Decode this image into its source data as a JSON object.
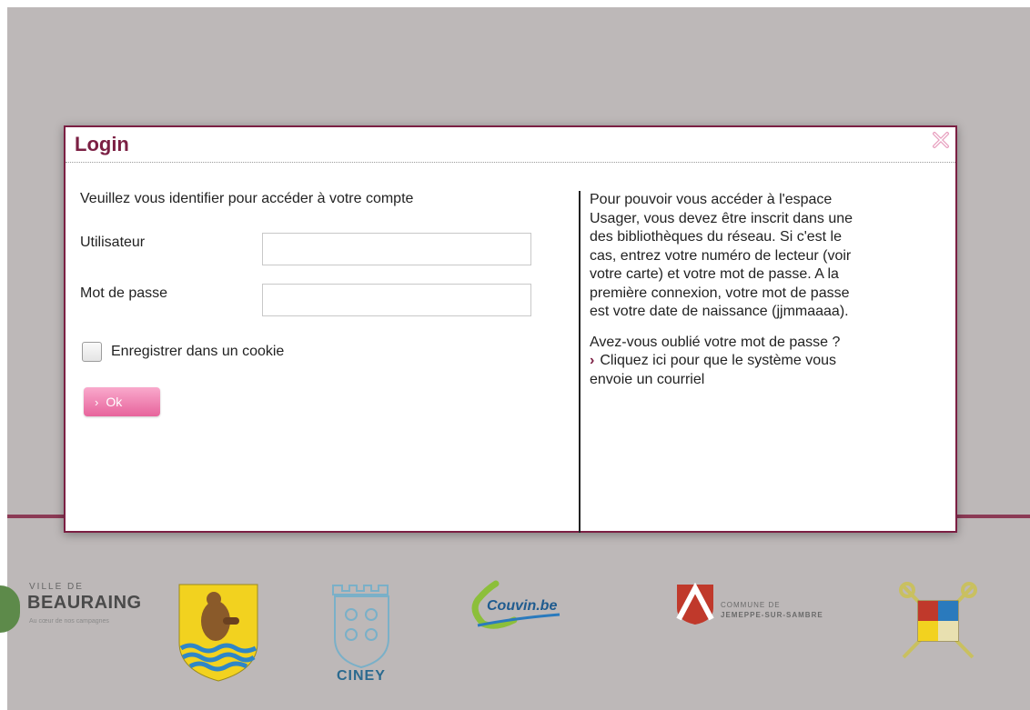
{
  "dialog": {
    "title": "Login",
    "close_icon": "close-x-icon",
    "intro": "Veuillez vous identifier pour accéder à votre compte",
    "username_label": "Utilisateur",
    "username_value": "",
    "password_label": "Mot de passe",
    "password_value": "",
    "cookie_label": "Enregistrer dans un cookie",
    "cookie_checked": false,
    "ok_label": "Ok",
    "info_text": "Pour pouvoir vous accéder à l'espace Usager, vous devez être inscrit dans une des bibliothèques du réseau. Si c'est le cas, entrez votre numéro de lecteur (voir votre carte) et votre mot de passe. A la première connexion, votre mot de passe est votre date de naissance (jjmmaaaa).",
    "forgot_question": "Avez-vous oublié votre mot de passe ?",
    "forgot_link": "Cliquez ici pour que le système vous envoie un courriel"
  },
  "logos": {
    "beauraing_small": "VILLE DE",
    "beauraing_name": "BEAURAING",
    "beauraing_tagline": "Au cœur de nos campagnes",
    "couvin": "Couvin.be",
    "ciney": "CINEY",
    "jemeppe_small": "COMMUNE DE",
    "jemeppe_name": "JEMEPPE-SUR-SAMBRE"
  },
  "colors": {
    "accent": "#7b1f43",
    "ok_button": "#e7649c",
    "page_background": "#bdb8b8"
  }
}
